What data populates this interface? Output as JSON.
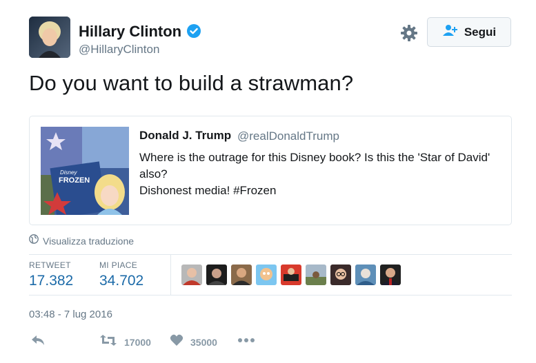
{
  "author": {
    "name": "Hillary Clinton",
    "handle": "@HillaryClinton",
    "verified": true
  },
  "follow_button": {
    "label": "Segui"
  },
  "tweet": {
    "text": "Do you want to build a strawman?"
  },
  "quoted_tweet": {
    "name": "Donald J. Trump",
    "handle": "@realDonaldTrump",
    "text_line1": "Where is the outrage for this Disney book? Is this the 'Star of David' also?",
    "text_line2": "Dishonest media! #Frozen",
    "image_text": {
      "brand": "Disney",
      "title": "FROZEN"
    }
  },
  "translate": {
    "label": "Visualizza traduzione"
  },
  "stats": {
    "retweets": {
      "label": "RETWEET",
      "value": "17.382"
    },
    "likes": {
      "label": "MI PIACE",
      "value": "34.702"
    }
  },
  "likers": [
    {
      "icon": "avatar-1"
    },
    {
      "icon": "avatar-2"
    },
    {
      "icon": "avatar-3"
    },
    {
      "icon": "avatar-4"
    },
    {
      "icon": "avatar-5"
    },
    {
      "icon": "avatar-6"
    },
    {
      "icon": "avatar-7"
    },
    {
      "icon": "avatar-8"
    },
    {
      "icon": "avatar-9"
    }
  ],
  "timestamp": "03:48 - 7 lug 2016",
  "actions": {
    "retweet_count": "17000",
    "like_count": "35000"
  },
  "colors": {
    "link_blue": "#1b6aa8",
    "verified_blue": "#1da1f2",
    "muted_gray": "#657786",
    "action_gray": "#8899a6"
  }
}
